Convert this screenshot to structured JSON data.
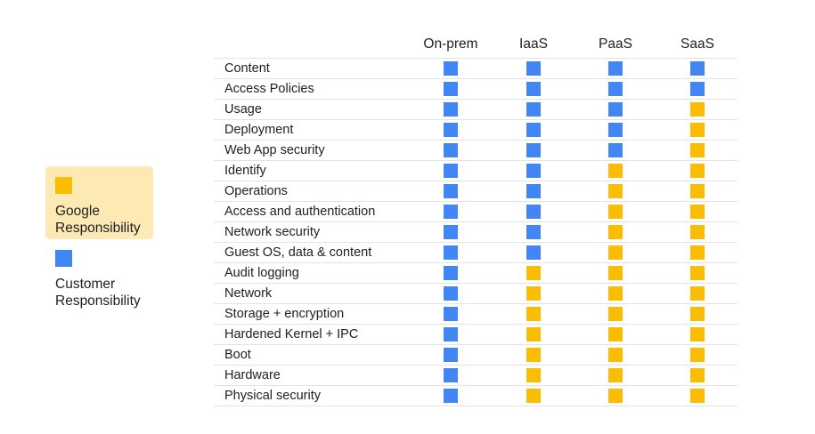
{
  "colors": {
    "google": "#fbbc04",
    "customer": "#4285f4"
  },
  "legend": {
    "google_label": "Google\nResponsibility",
    "customer_label": "Customer\nResponsibility"
  },
  "columns": [
    "On-prem",
    "IaaS",
    "PaaS",
    "SaaS"
  ],
  "rows": [
    {
      "label": "Content",
      "cells": [
        "customer",
        "customer",
        "customer",
        "customer"
      ]
    },
    {
      "label": "Access Policies",
      "cells": [
        "customer",
        "customer",
        "customer",
        "customer"
      ]
    },
    {
      "label": "Usage",
      "cells": [
        "customer",
        "customer",
        "customer",
        "google"
      ]
    },
    {
      "label": "Deployment",
      "cells": [
        "customer",
        "customer",
        "customer",
        "google"
      ]
    },
    {
      "label": "Web App security",
      "cells": [
        "customer",
        "customer",
        "customer",
        "google"
      ]
    },
    {
      "label": "Identify",
      "cells": [
        "customer",
        "customer",
        "google",
        "google"
      ]
    },
    {
      "label": "Operations",
      "cells": [
        "customer",
        "customer",
        "google",
        "google"
      ]
    },
    {
      "label": "Access and authentication",
      "cells": [
        "customer",
        "customer",
        "google",
        "google"
      ]
    },
    {
      "label": "Network security",
      "cells": [
        "customer",
        "customer",
        "google",
        "google"
      ]
    },
    {
      "label": "Guest OS, data & content",
      "cells": [
        "customer",
        "customer",
        "google",
        "google"
      ]
    },
    {
      "label": "Audit logging",
      "cells": [
        "customer",
        "google",
        "google",
        "google"
      ]
    },
    {
      "label": "Network",
      "cells": [
        "customer",
        "google",
        "google",
        "google"
      ]
    },
    {
      "label": "Storage + encryption",
      "cells": [
        "customer",
        "google",
        "google",
        "google"
      ]
    },
    {
      "label": "Hardened Kernel + IPC",
      "cells": [
        "customer",
        "google",
        "google",
        "google"
      ]
    },
    {
      "label": "Boot",
      "cells": [
        "customer",
        "google",
        "google",
        "google"
      ]
    },
    {
      "label": "Hardware",
      "cells": [
        "customer",
        "google",
        "google",
        "google"
      ]
    },
    {
      "label": "Physical security",
      "cells": [
        "customer",
        "google",
        "google",
        "google"
      ]
    }
  ]
}
